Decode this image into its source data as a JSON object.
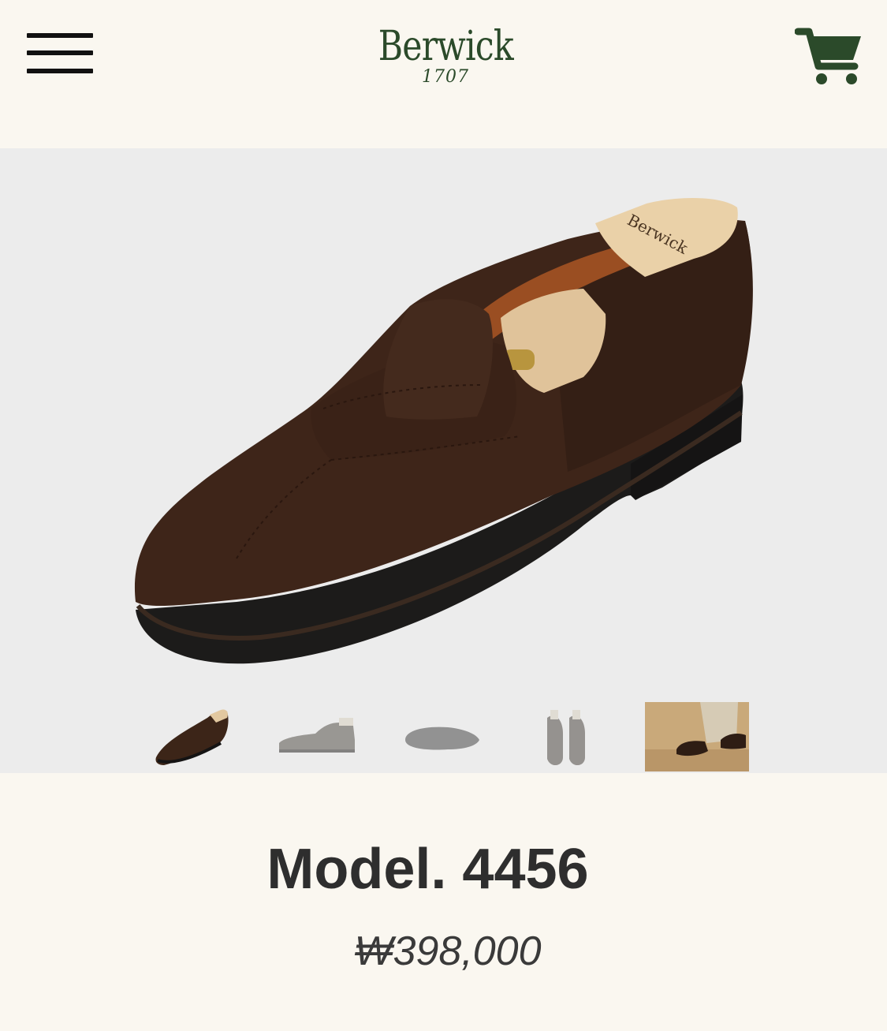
{
  "header": {
    "brand_name": "Berwick",
    "brand_year": "1707",
    "menu_icon": "hamburger-menu-icon",
    "cart_icon": "shopping-cart-icon",
    "brand_color": "#2b4a2a"
  },
  "gallery": {
    "main_image": "suede-penny-loafer-with-shoe-tree",
    "selected_index": 0,
    "thumbnails": [
      {
        "image": "loafer-angled-view"
      },
      {
        "image": "loafer-side-view"
      },
      {
        "image": "loafer-sole-view"
      },
      {
        "image": "loafer-pair-top-view"
      },
      {
        "image": "loafer-worn-lifestyle-view"
      }
    ]
  },
  "product": {
    "title": "Model. 4456",
    "price": "₩398,000"
  },
  "colors": {
    "page_background": "#faf7f0",
    "gallery_background": "#ececec",
    "title_text": "#2e2e2e"
  }
}
